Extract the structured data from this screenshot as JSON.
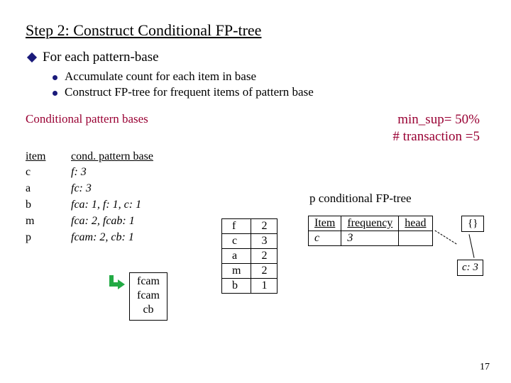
{
  "title": "Step 2: Construct Conditional FP-tree",
  "heading": "For each pattern-base",
  "bullets": [
    "Accumulate count for each item in base",
    "Construct FP-tree for frequent items of pattern base"
  ],
  "cpb_label": "Conditional pattern bases",
  "min_sup": "min_sup= 50%",
  "trans_count": "# transaction =5",
  "table": {
    "headers": {
      "item": "item",
      "base": "cond. pattern base"
    },
    "rows": [
      {
        "item": "c",
        "base": "f: 3"
      },
      {
        "item": "a",
        "base": "fc: 3"
      },
      {
        "item": "b",
        "base": "fca: 1, f: 1, c: 1"
      },
      {
        "item": "m",
        "base": "fca: 2, fcab: 1"
      },
      {
        "item": "p",
        "base": "fcam: 2, cb: 1"
      }
    ]
  },
  "fcam_box": {
    "l1": "fcam",
    "l2": "fcam",
    "l3": "cb"
  },
  "mini_table": [
    {
      "k": "f",
      "v": "2"
    },
    {
      "k": "c",
      "v": "3"
    },
    {
      "k": "a",
      "v": "2"
    },
    {
      "k": "m",
      "v": "2"
    },
    {
      "k": "b",
      "v": "1"
    }
  ],
  "pcond_label": "p conditional FP-tree",
  "freq_table": {
    "headers": {
      "a": "Item",
      "b": "frequency",
      "c": "head"
    },
    "row": {
      "a": "c",
      "b": "3",
      "c": ""
    }
  },
  "root_label": "{}",
  "c3_label": "c: 3",
  "page_num": "17"
}
